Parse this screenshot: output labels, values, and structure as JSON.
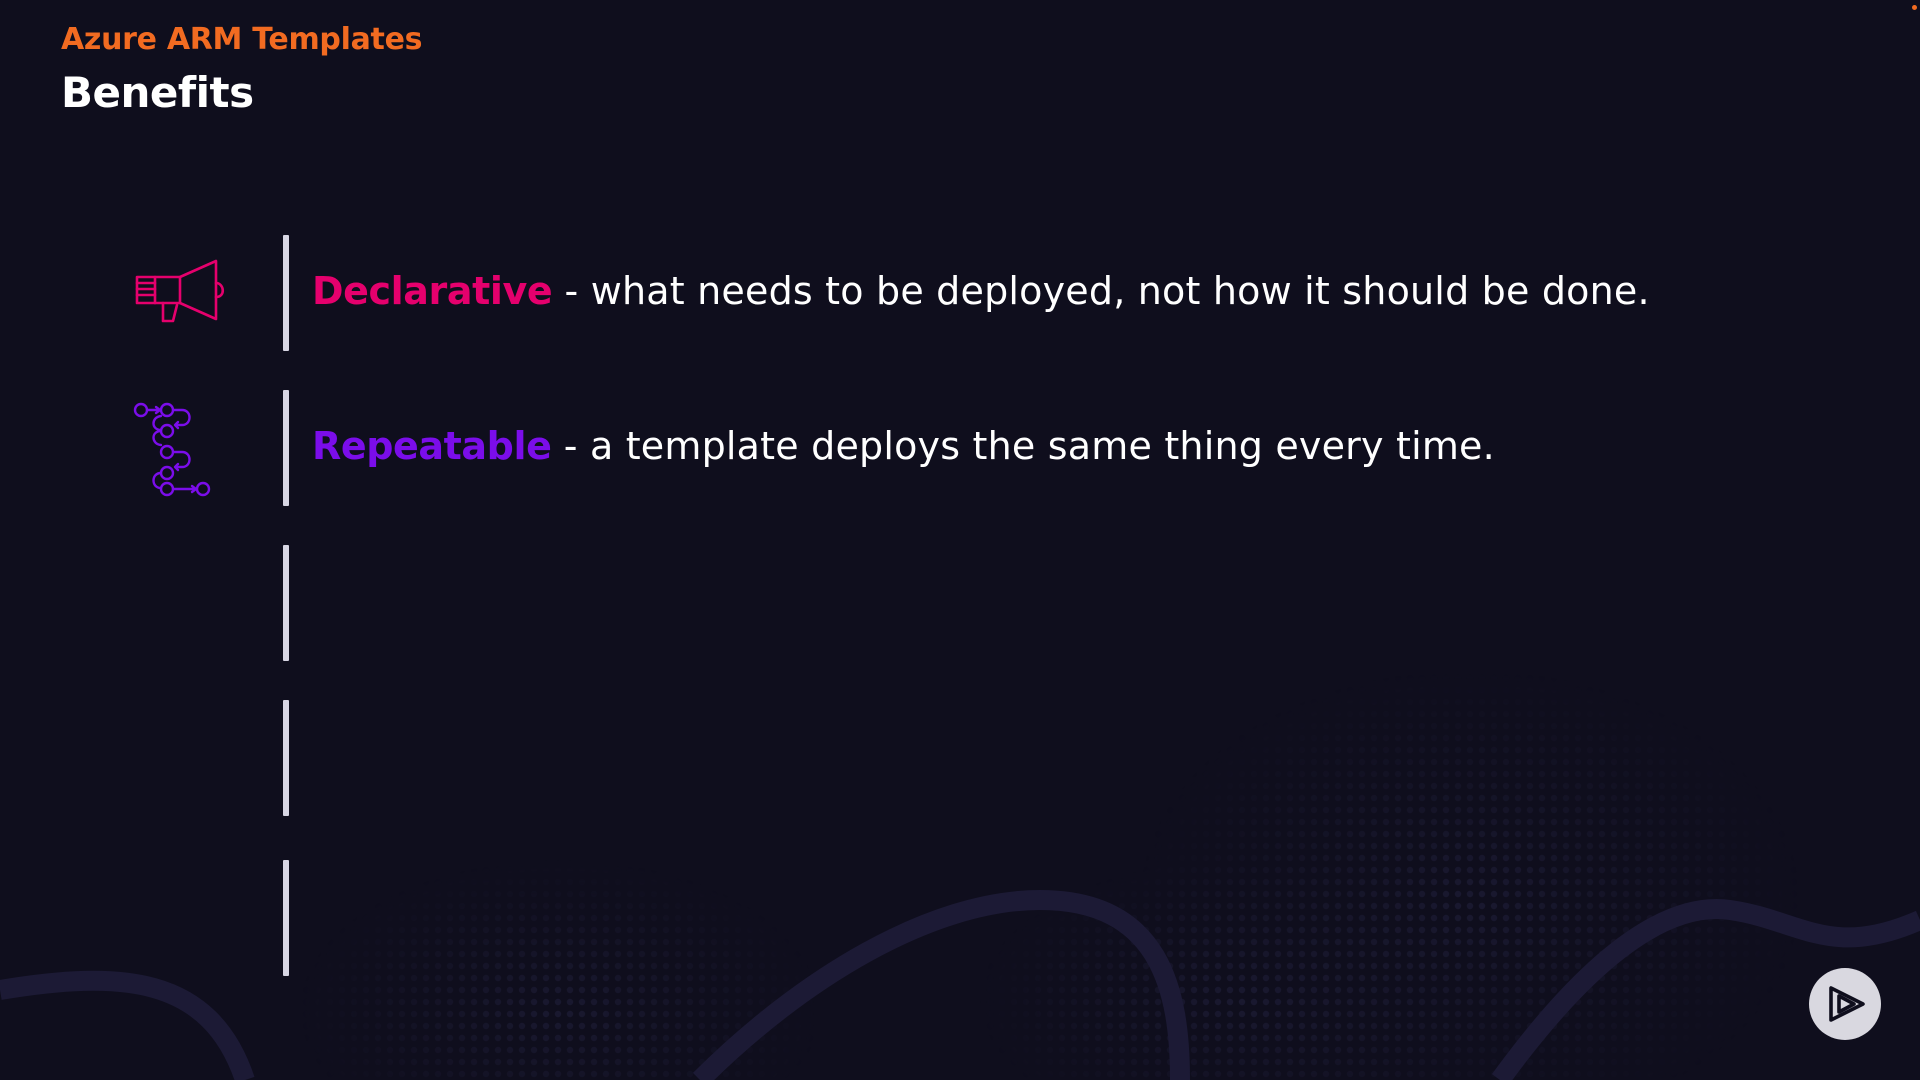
{
  "slide": {
    "eyebrow": "Azure ARM Templates",
    "title": "Benefits"
  },
  "benefits": [
    {
      "icon": "megaphone-icon",
      "keyword": "Declarative",
      "description": " - what needs to be deployed, not how it should be done."
    },
    {
      "icon": "workflow-icon",
      "keyword": "Repeatable",
      "description": " - a template deploys the same thing every time."
    },
    {
      "keyword": "",
      "description": ""
    },
    {
      "keyword": "",
      "description": ""
    },
    {
      "keyword": "",
      "description": ""
    }
  ],
  "player": {
    "icon": "play-logo-icon"
  },
  "colors": {
    "background": "#0f0e1d",
    "eyebrow": "#f26b21",
    "title": "#ffffff",
    "declarative": "#e5006d",
    "repeatable": "#7b0dea",
    "divider": "#d8d6e4",
    "decor": "#1c1a35",
    "player_bg": "#d9d8e0"
  }
}
